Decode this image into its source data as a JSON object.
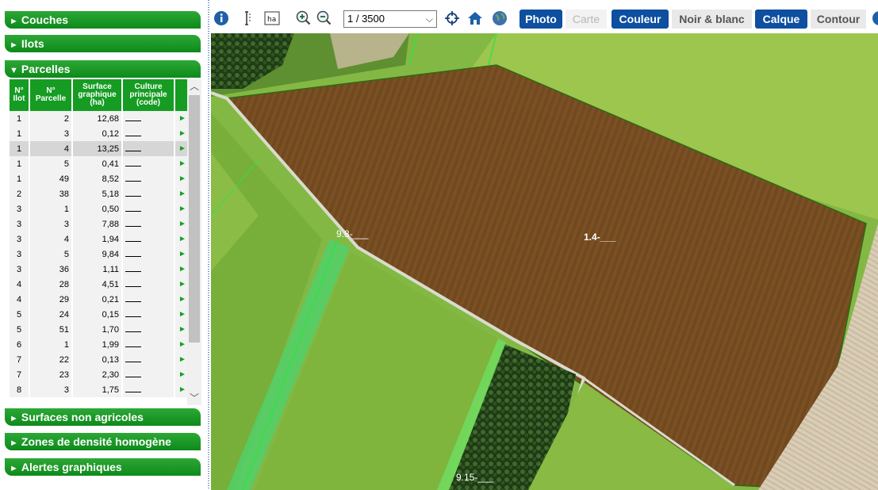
{
  "panel": {
    "couches": "Couches",
    "ilots": "Ilots",
    "parcelles": "Parcelles",
    "surfaces": "Surfaces non agricoles",
    "zones": "Zones de densité homogène",
    "alertes": "Alertes graphiques",
    "arrow_collapsed": "►",
    "arrow_expanded": "▼"
  },
  "table": {
    "headers": [
      "N° Ilot",
      "N° Parcelle",
      "Surface graphique (ha)",
      "Culture principale (code)"
    ],
    "rows": [
      {
        "ilot": "1",
        "parcelle": "2",
        "surface": "12,68"
      },
      {
        "ilot": "1",
        "parcelle": "3",
        "surface": "0,12"
      },
      {
        "ilot": "1",
        "parcelle": "4",
        "surface": "13,25"
      },
      {
        "ilot": "1",
        "parcelle": "5",
        "surface": "0,41"
      },
      {
        "ilot": "1",
        "parcelle": "49",
        "surface": "8,52"
      },
      {
        "ilot": "2",
        "parcelle": "38",
        "surface": "5,18"
      },
      {
        "ilot": "3",
        "parcelle": "1",
        "surface": "0,50"
      },
      {
        "ilot": "3",
        "parcelle": "3",
        "surface": "7,88"
      },
      {
        "ilot": "3",
        "parcelle": "4",
        "surface": "1,94"
      },
      {
        "ilot": "3",
        "parcelle": "5",
        "surface": "9,84"
      },
      {
        "ilot": "3",
        "parcelle": "36",
        "surface": "1,11"
      },
      {
        "ilot": "4",
        "parcelle": "28",
        "surface": "4,51"
      },
      {
        "ilot": "4",
        "parcelle": "29",
        "surface": "0,21"
      },
      {
        "ilot": "5",
        "parcelle": "24",
        "surface": "0,15"
      },
      {
        "ilot": "5",
        "parcelle": "51",
        "surface": "1,70"
      },
      {
        "ilot": "6",
        "parcelle": "1",
        "surface": "1,99"
      },
      {
        "ilot": "7",
        "parcelle": "22",
        "surface": "0,13"
      },
      {
        "ilot": "7",
        "parcelle": "23",
        "surface": "2,30"
      },
      {
        "ilot": "8",
        "parcelle": "3",
        "surface": "1,75"
      }
    ],
    "selected_row": 2
  },
  "toolbar": {
    "scale": "1 / 3500",
    "photo": "Photo",
    "carte": "Carte",
    "couleur": "Couleur",
    "noir_blanc": "Noir & blanc",
    "calque": "Calque",
    "contour": "Contour",
    "icons": [
      "info-icon",
      "measure-icon",
      "area-ha-icon",
      "zoom-in-icon",
      "zoom-out-icon",
      "crosshair-icon",
      "home-icon",
      "globe-icon"
    ]
  },
  "map": {
    "labels": [
      "1.4-___",
      "9.8-___",
      "9.15-___"
    ]
  },
  "colors": {
    "accordion": "#169c23",
    "toggle_on": "#0e4fa0",
    "parcel_selected": "#7a4a1f",
    "parcel_green": "#7db53a"
  }
}
